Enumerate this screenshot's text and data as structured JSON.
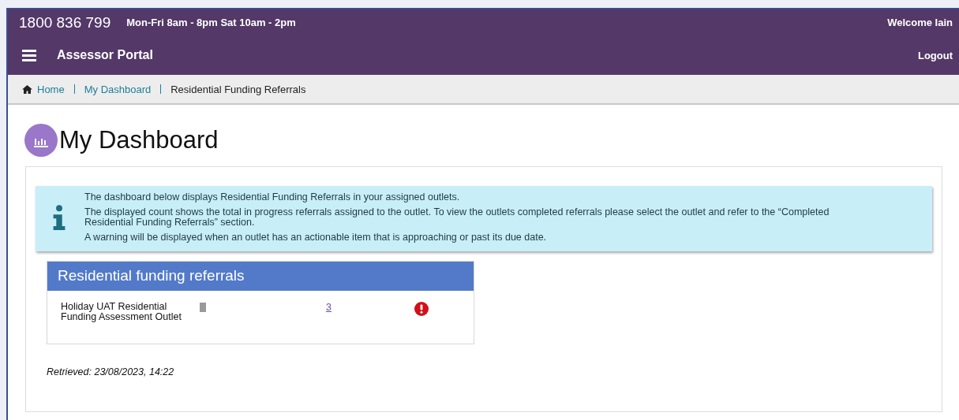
{
  "header": {
    "phone": "1800 836 799",
    "hours": "Mon-Fri 8am - 8pm Sat 10am - 2pm",
    "welcome": "Welcome Iain",
    "portal_title": "Assessor Portal",
    "logout": "Logout"
  },
  "breadcrumb": [
    {
      "label": "Home",
      "kind": "link"
    },
    {
      "label": "My Dashboard",
      "kind": "link"
    },
    {
      "label": "Residential Funding Referrals",
      "kind": "current"
    }
  ],
  "page_title": "My Dashboard",
  "info": [
    "The dashboard below displays Residential Funding Referrals in your assigned outlets.",
    "The displayed count shows the total in progress referrals assigned to the outlet. To view the outlets completed referrals please select the outlet and refer to the “Completed Residential Funding Referrals” section.",
    "A warning will be displayed when an outlet has an actionable item that is approaching or past its due date."
  ],
  "panel": {
    "title": "Residential funding referrals",
    "rows": [
      {
        "outlet": "Holiday UAT Residential Funding Assessment Outlet",
        "count": "3",
        "warning": true
      }
    ]
  },
  "retrieved": "Retrieved: 23/08/2023, 14:22"
}
